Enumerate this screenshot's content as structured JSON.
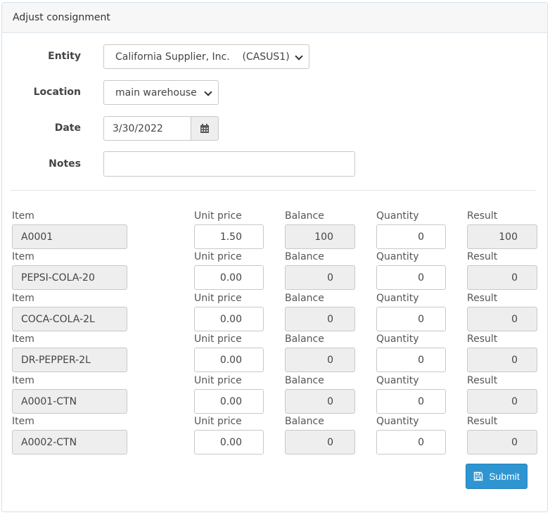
{
  "title": "Adjust consignment",
  "form": {
    "entity_label": "Entity",
    "entity_value": "California Supplier, Inc.    (CASUS1)",
    "location_label": "Location",
    "location_value": "main warehouse",
    "date_label": "Date",
    "date_value": "3/30/2022",
    "notes_label": "Notes",
    "notes_value": ""
  },
  "columns": {
    "item": "Item",
    "unit_price": "Unit price",
    "balance": "Balance",
    "quantity": "Quantity",
    "result": "Result"
  },
  "rows": [
    {
      "item": "A0001",
      "unit_price": "1.50",
      "balance": "100",
      "quantity": "0",
      "result": "100"
    },
    {
      "item": "PEPSI-COLA-20",
      "unit_price": "0.00",
      "balance": "0",
      "quantity": "0",
      "result": "0"
    },
    {
      "item": "COCA-COLA-2L",
      "unit_price": "0.00",
      "balance": "0",
      "quantity": "0",
      "result": "0"
    },
    {
      "item": "DR-PEPPER-2L",
      "unit_price": "0.00",
      "balance": "0",
      "quantity": "0",
      "result": "0"
    },
    {
      "item": "A0001-CTN",
      "unit_price": "0.00",
      "balance": "0",
      "quantity": "0",
      "result": "0"
    },
    {
      "item": "A0002-CTN",
      "unit_price": "0.00",
      "balance": "0",
      "quantity": "0",
      "result": "0"
    }
  ],
  "submit_label": "Submit",
  "icons": {
    "calendar": "calendar-icon",
    "save": "save-icon"
  },
  "colors": {
    "accent": "#2e95d1",
    "readonly_bg": "#eeeeee"
  }
}
